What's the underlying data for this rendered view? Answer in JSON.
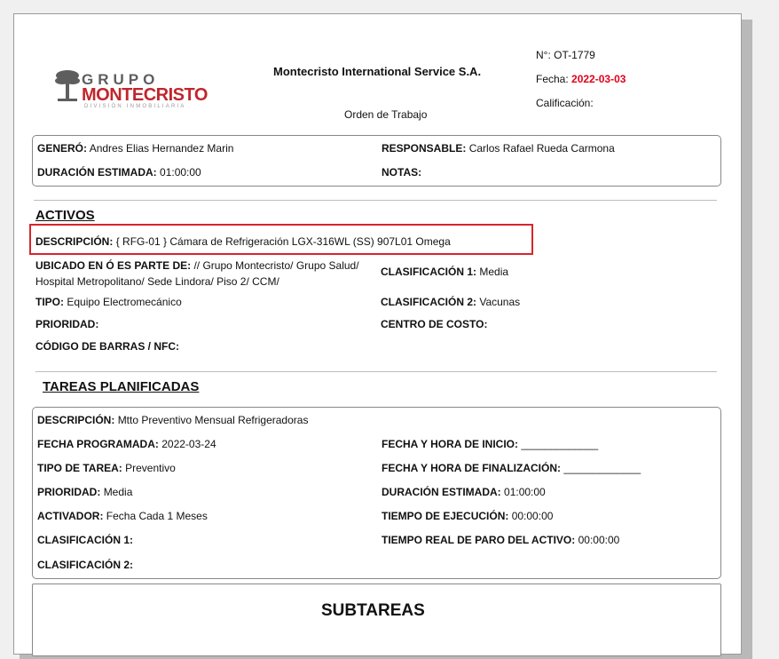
{
  "logo": {
    "grupo": "GRUPO",
    "montecristo": "MONTECRISTO",
    "division": "DIVISIÓN INMOBILIARIA"
  },
  "header": {
    "company": "Montecristo International Service S.A.",
    "document_type": "Orden de Trabajo",
    "number_label": "N°:",
    "number_value": "OT-1779",
    "date_label": "Fecha:",
    "date_value": "2022-03-03",
    "rating_label": "Calificación:"
  },
  "info": {
    "genero_label": "GENERÓ:",
    "genero_value": "Andres Elias Hernandez Marin",
    "responsable_label": "RESPONSABLE:",
    "responsable_value": "Carlos Rafael Rueda Carmona",
    "duracion_label": "DURACIÓN ESTIMADA:",
    "duracion_value": "01:00:00",
    "notas_label": "NOTAS:"
  },
  "activos": {
    "title": "ACTIVOS",
    "descripcion_label": "DESCRIPCIÓN:",
    "descripcion_value": "{ RFG-01 } Cámara de Refrigeración LGX-316WL (SS) 907L01 Omega",
    "ubicado_label": "UBICADO EN Ó ES PARTE DE:",
    "ubicado_value_1": "// Grupo Montecristo/ Grupo Salud/",
    "ubicado_value_2": "Hospital Metropolitano/ Sede Lindora/ Piso 2/ CCM/",
    "clasif1_label": "CLASIFICACIÓN 1:",
    "clasif1_value": "Media",
    "tipo_label": "TIPO:",
    "tipo_value": "Equipo Electromecánico",
    "clasif2_label": "CLASIFICACIÓN 2:",
    "clasif2_value": "Vacunas",
    "prioridad_label": "PRIORIDAD:",
    "centro_label": "CENTRO DE COSTO:",
    "barras_label": "CÓDIGO DE BARRAS / NFC:"
  },
  "tareas": {
    "title": "TAREAS PLANIFICADAS",
    "descripcion_label": "DESCRIPCIÓN:",
    "descripcion_value": "Mtto Preventivo Mensual Refrigeradoras",
    "fecha_prog_label": "FECHA PROGRAMADA:",
    "fecha_prog_value": "2022-03-24",
    "inicio_label": "FECHA Y HORA DE INICIO:",
    "inicio_value": "_____________",
    "tipo_label": "TIPO DE TAREA:",
    "tipo_value": "Preventivo",
    "fin_label": "FECHA Y HORA DE FINALIZACIÓN:",
    "fin_value": "_____________",
    "prioridad_label": "PRIORIDAD:",
    "prioridad_value": "Media",
    "duracion_label": "DURACIÓN ESTIMADA:",
    "duracion_value": "01:00:00",
    "activador_label": "ACTIVADOR:",
    "activador_value": "Fecha Cada 1 Meses",
    "ejecucion_label": "TIEMPO DE EJECUCIÓN:",
    "ejecucion_value": "00:00:00",
    "clasif1_label": "CLASIFICACIÓN 1:",
    "paro_label": "TIEMPO REAL DE PARO DEL ACTIVO:",
    "paro_value": "00:00:00",
    "clasif2_label": "CLASIFICACIÓN 2:"
  },
  "subtareas": {
    "title": "SUBTAREAS"
  },
  "colors": {
    "accent_red": "#d7252c",
    "date_red": "#e0001b",
    "logo_red": "#c0262d"
  }
}
